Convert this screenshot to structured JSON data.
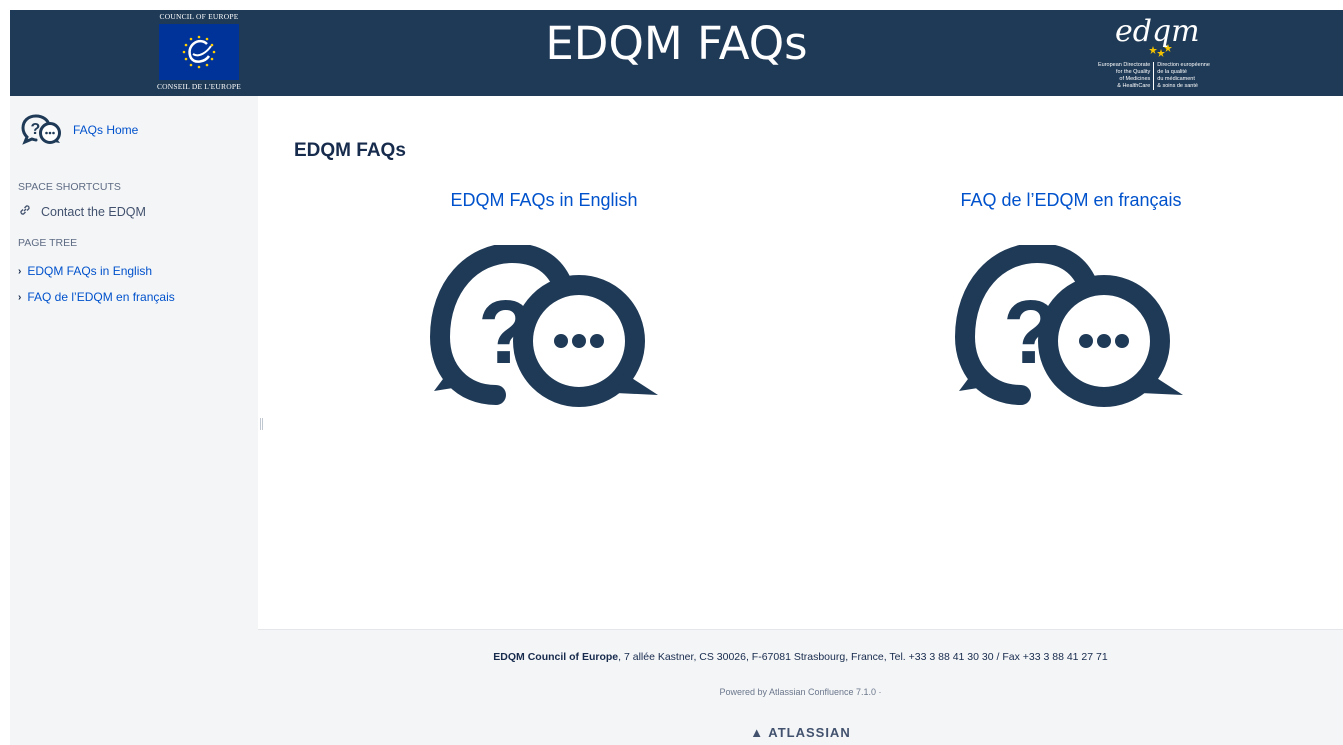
{
  "header": {
    "title": "EDQM FAQs",
    "coe_top": "COUNCIL OF EUROPE",
    "coe_bottom": "CONSEIL DE L'EUROPE",
    "edqm_word": "edqm",
    "edqm_left": [
      "European Directorate",
      "for the Quality",
      "of Medicines",
      "& HealthCare"
    ],
    "edqm_right": [
      "Direction européenne",
      "de la qualité",
      "du médicament",
      "& soins de santé"
    ],
    "bg": "#1f3a57"
  },
  "sidebar": {
    "home_label": "FAQs Home",
    "shortcuts_heading": "SPACE SHORTCUTS",
    "shortcut_label": "Contact the EDQM",
    "tree_heading": "PAGE TREE",
    "tree_items": [
      {
        "label": "EDQM FAQs in English"
      },
      {
        "label": "FAQ de l’EDQM en français"
      }
    ]
  },
  "main": {
    "title": "EDQM FAQs",
    "columns": [
      {
        "label": "EDQM FAQs in English",
        "icon": "faq-bubbles-icon"
      },
      {
        "label": "FAQ de l’EDQM en français",
        "icon": "faq-bubbles-icon"
      }
    ]
  },
  "footer": {
    "org": "EDQM Council of Europe",
    "address": ", 7 allée Kastner, CS 30026, F-67081 Strasbourg, France, Tel. +33 3 88 41 30 30 / Fax +33 3 88 41 27 71",
    "powered": "Powered by Atlassian Confluence 7.1.0  ·",
    "atlassian": "ATLASSIAN"
  },
  "colors": {
    "link": "#0052cc",
    "icon": "#1f3a57"
  }
}
